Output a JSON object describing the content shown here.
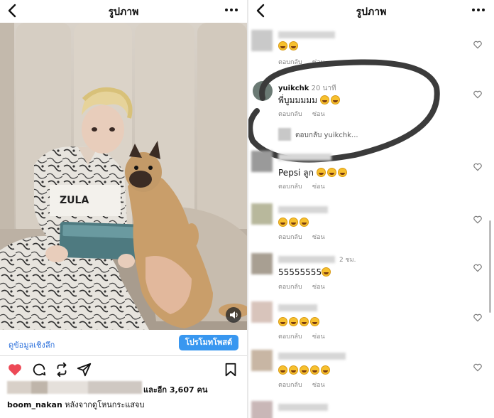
{
  "left": {
    "header": {
      "title": "รูปภาพ"
    },
    "actions": {
      "insights": "ดูข้อมูลเชิงลึก",
      "promote": "โปรโมทโพสต์"
    },
    "likes": {
      "text": "และอีก 3,607 คน"
    },
    "caption": {
      "username": "boom_nakan",
      "text": "หลังจากดูโหนกระแสจบ"
    },
    "shirt_print": "ZULA"
  },
  "right": {
    "header": {
      "title": "รูปภาพ"
    },
    "labels": {
      "reply": "ตอบกลับ",
      "hide": "ซ่อน"
    },
    "highlighted": {
      "username": "yuikchk",
      "time": "20 นาที",
      "text": "พี่บูมมมมม",
      "view_replies": "ตอบกลับ yuikchk..."
    },
    "comments": [
      {
        "text": "Pepsi ลูก"
      },
      {
        "text": "55555555"
      },
      {
        "time": "2 ชม."
      }
    ]
  },
  "colors": {
    "accent": "#3897f0",
    "like_red": "#ed4956",
    "link_blue": "#2a6fdb"
  }
}
